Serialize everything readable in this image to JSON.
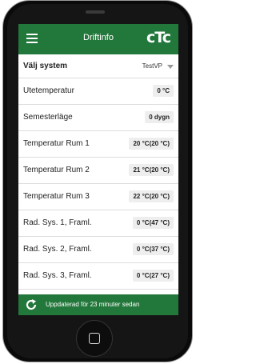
{
  "app": {
    "title": "Driftinfo",
    "logo": "cTc",
    "menu_icon": "hamburger-icon"
  },
  "system": {
    "label": "Välj system",
    "selected": "TestVP"
  },
  "rows": [
    {
      "label": "Utetemperatur",
      "value": "0 °C"
    },
    {
      "label": "Semesterläge",
      "value": "0 dygn"
    },
    {
      "label": "Temperatur Rum 1",
      "value": "20 °C(20 °C)"
    },
    {
      "label": "Temperatur Rum 2",
      "value": "21 °C(20 °C)"
    },
    {
      "label": "Temperatur Rum 3",
      "value": "22 °C(20 °C)"
    },
    {
      "label": "Rad. Sys. 1, Framl.",
      "value": "0 °C(47 °C)"
    },
    {
      "label": "Rad. Sys. 2, Framl.",
      "value": "0 °C(37 °C)"
    },
    {
      "label": "Rad. Sys. 3, Framl.",
      "value": "0 °C(27 °C)"
    }
  ],
  "status": {
    "text": "Uppdaterad för 23 minuter sedan",
    "icon": "refresh-icon"
  },
  "colors": {
    "brand_green": "#22773a",
    "value_bg": "#eeeeee"
  }
}
